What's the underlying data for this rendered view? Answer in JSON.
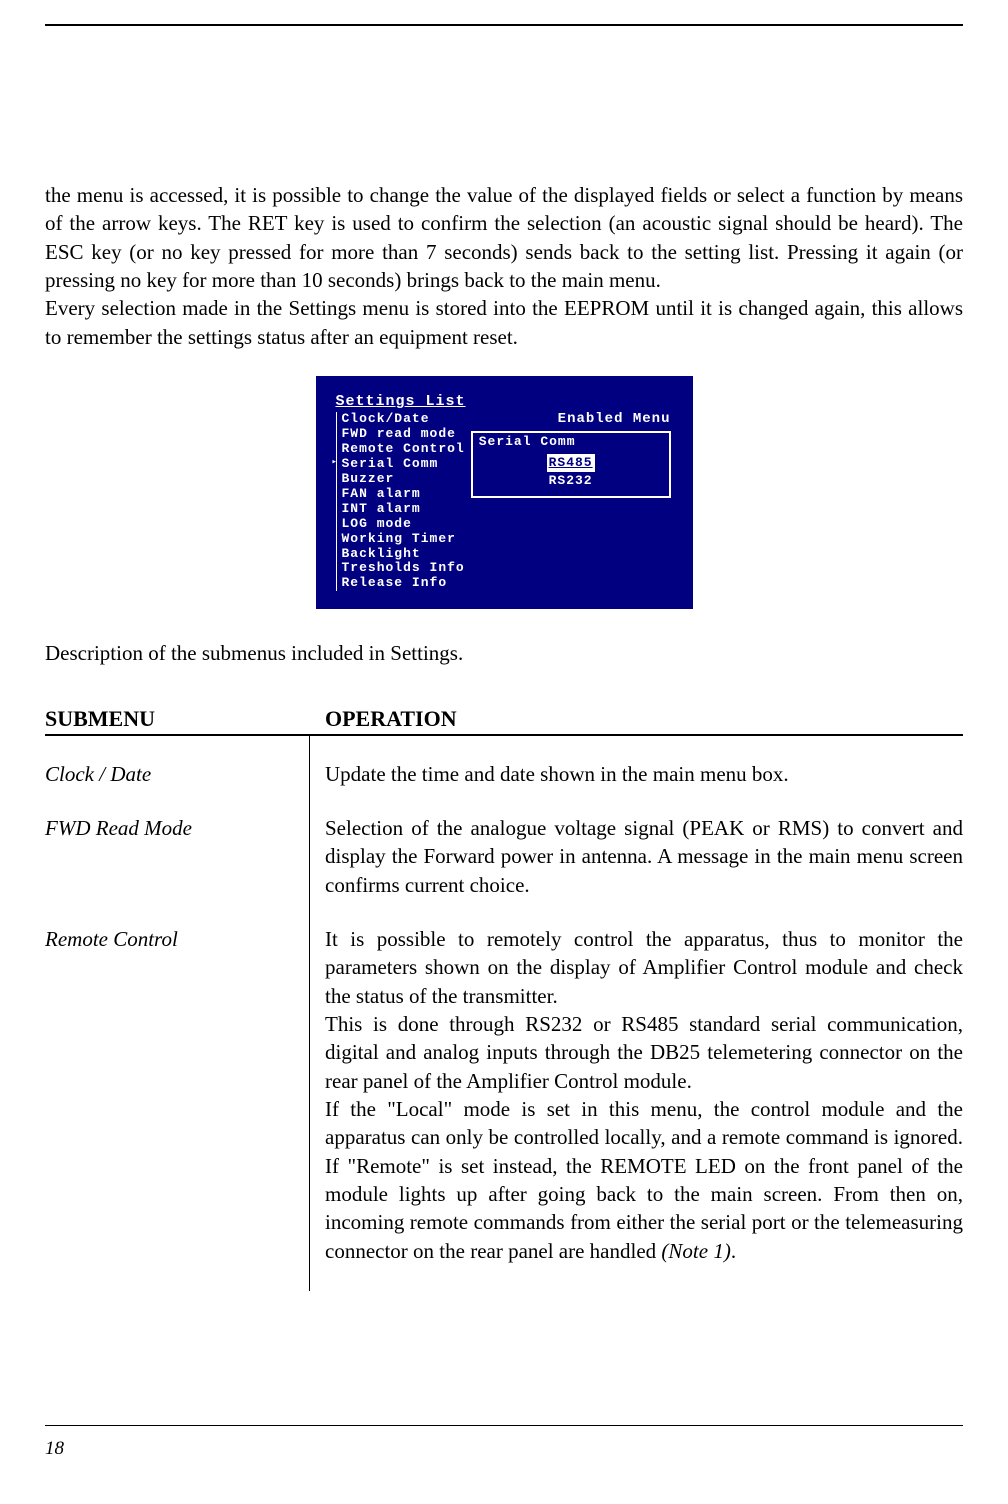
{
  "intro": {
    "para1": "the menu is accessed, it is possible to change the value of the displayed fields or select a function by means of the arrow keys. The RET key is used to confirm the selection (an acoustic signal should be heard). The ESC key (or no key pressed for more than 7 seconds) sends back to the setting list. Pressing it again (or pressing no key for more than 10 seconds) brings back to the main menu.",
    "para2": "Every selection made in the Settings menu is stored into the EEPROM until it is changed again, this allows to remember the settings status after an equipment reset."
  },
  "lcd": {
    "title": "Settings List",
    "enabled_label": "Enabled Menu",
    "items": {
      "i0": "Clock/Date",
      "i1": "FWD read mode",
      "i2": "Remote Control",
      "i3": "Serial Comm",
      "i4": "Buzzer",
      "i5": "FAN alarm",
      "i6": "INT alarm",
      "i7": "LOG mode",
      "i8": "Working Timer",
      "i9": "Backlight",
      "i10": "Tresholds Info",
      "i11": "Release Info"
    },
    "panel_title": "Serial Comm",
    "opt_selected": "RS485",
    "opt_other": "RS232"
  },
  "desc_line": "Description of the submenus included in Settings.",
  "table": {
    "header_left": "SUBMENU",
    "header_right": "OPERATION",
    "rows": {
      "r0": {
        "name": "Clock / Date",
        "op": "Update the time and date shown in the main menu box."
      },
      "r1": {
        "name": "FWD Read Mode",
        "op": "Selection of the analogue voltage signal (PEAK or RMS) to convert and display the Forward power in antenna. A message in the main menu screen confirms current choice."
      },
      "r2": {
        "name": "Remote Control",
        "op_p1": "It is possible to remotely control the apparatus, thus to monitor the parameters shown on the display of Amplifier Control module and check the status of the transmitter.",
        "op_p2": "This is done through RS232 or RS485 standard serial communication, digital and analog inputs through the DB25 telemetering connector on the rear panel of the Amplifier Control module.",
        "op_p3a": "If the \"Local\" mode is set in this menu, the control module and the apparatus can only be controlled locally, and a remote command is ignored. If \"Remote\" is set instead, the REMOTE LED on the front panel of the module lights up after going back to the main screen. From then on, incoming remote commands from either the serial port or the telemeasuring connector on the rear panel are handled ",
        "note": "(Note 1)",
        "op_p3b": "."
      }
    }
  },
  "page_number": "18"
}
